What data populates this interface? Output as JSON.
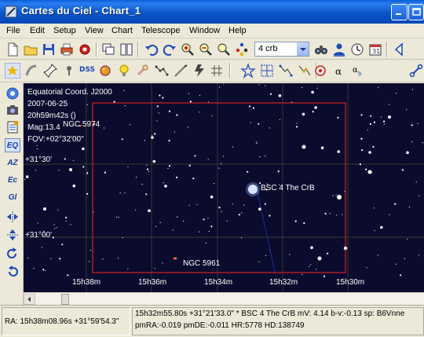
{
  "window": {
    "title": "Cartes du Ciel - Chart_1"
  },
  "menu": [
    "File",
    "Edit",
    "Setup",
    "View",
    "Chart",
    "Telescope",
    "Window",
    "Help"
  ],
  "toolbar": {
    "search_value": "4 crb",
    "dss_label": "DSS"
  },
  "leftbar": {
    "eq": "EQ",
    "az": "AZ",
    "ec": "Ec",
    "gl": "Gl"
  },
  "chart": {
    "info": [
      "Equatorial Coord. J2000",
      "2007-06-25",
      "20h59m42s ()",
      "Mag:13.4",
      "FOV:+02°32'00\""
    ],
    "dec_labels": [
      "+31°30'",
      "+31°00'"
    ],
    "ra_labels": [
      "15h38m",
      "15h36m",
      "15h34m",
      "15h32m",
      "15h30m"
    ],
    "objects": {
      "ngc5974": "NGC 5974",
      "bsc4": "BSC 4 The CrB",
      "ngc5961": "NGC 5961"
    }
  },
  "status": {
    "left": "RA: 15h38m08.96s +31°59'54.3\"",
    "right1": "15h32m55.80s +31°21'33.0\" * BSC 4 The CrB mV: 4.14 b-v:-0.13 sp: B6Vnne",
    "right2": "pmRA:-0.019 pmDE:-0.011 HR:5778 HD:138749"
  },
  "colors": {
    "sky": "#0b0b2e",
    "frame": "#d42020",
    "grid": "#4a4a3a",
    "title_bar": "#0b55c9"
  }
}
